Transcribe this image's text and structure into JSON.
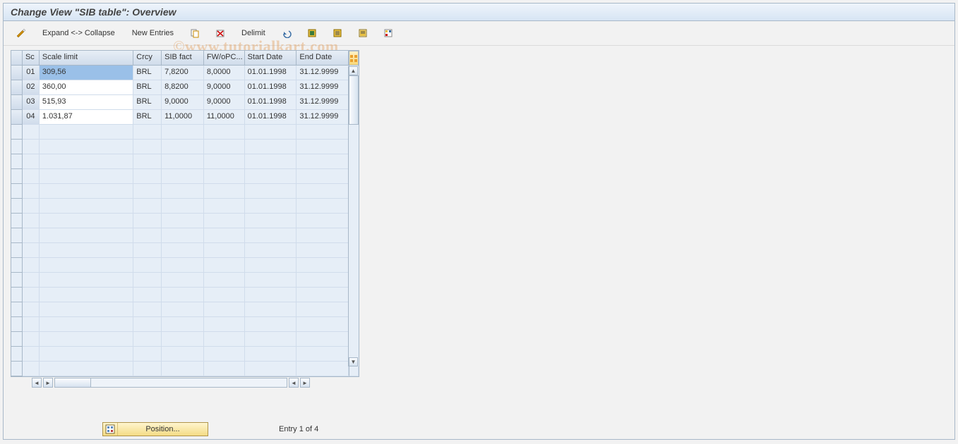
{
  "title": "Change View \"SIB table\": Overview",
  "toolbar": {
    "expand_collapse": "Expand <-> Collapse",
    "new_entries": "New Entries",
    "delimit": "Delimit"
  },
  "columns": {
    "sc": "Sc",
    "scale_limit": "Scale limit",
    "crcy": "Crcy",
    "sib_fact": "SIB fact",
    "fw_opc": "FW/oPC...",
    "start_date": "Start Date",
    "end_date": "End Date"
  },
  "rows": [
    {
      "sc": "01",
      "scale_limit": "309,56",
      "crcy": "BRL",
      "sib_fact": "7,8200",
      "fw_opc": "8,0000",
      "start_date": "01.01.1998",
      "end_date": "31.12.9999"
    },
    {
      "sc": "02",
      "scale_limit": "360,00",
      "crcy": "BRL",
      "sib_fact": "8,8200",
      "fw_opc": "9,0000",
      "start_date": "01.01.1998",
      "end_date": "31.12.9999"
    },
    {
      "sc": "03",
      "scale_limit": "515,93",
      "crcy": "BRL",
      "sib_fact": "9,0000",
      "fw_opc": "9,0000",
      "start_date": "01.01.1998",
      "end_date": "31.12.9999"
    },
    {
      "sc": "04",
      "scale_limit": "1.031,87",
      "crcy": "BRL",
      "sib_fact": "11,0000",
      "fw_opc": "11,0000",
      "start_date": "01.01.1998",
      "end_date": "31.12.9999"
    }
  ],
  "empty_row_count": 17,
  "footer": {
    "position_label": "Position...",
    "entry_text": "Entry 1 of 4"
  },
  "watermark": "©www.tutorialkart.com"
}
